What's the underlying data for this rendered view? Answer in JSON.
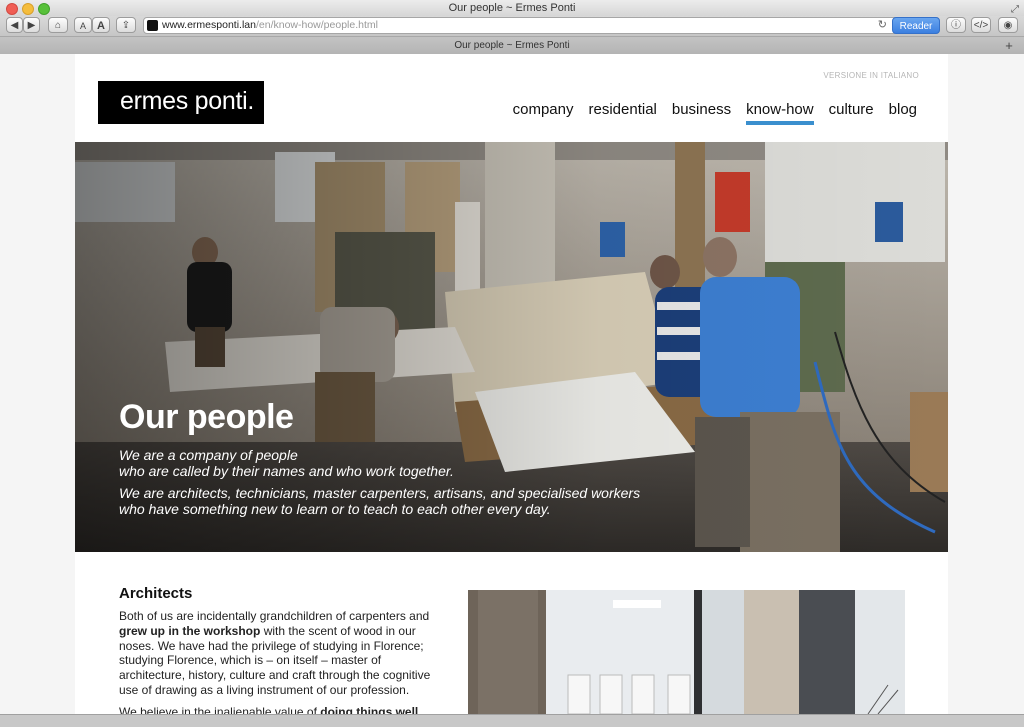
{
  "window": {
    "title": "Our people ~ Ermes Ponti",
    "tab_title": "Our people ~ Ermes Ponti"
  },
  "toolbar": {
    "url_host": "www.ermesponti.lan",
    "url_path": "/en/know-how/people.html",
    "reader_label": "Reader",
    "font_small": "A",
    "font_large": "A"
  },
  "site": {
    "lang_link": "VERSIONE IN ITALIANO",
    "logo_text": "ermes ponti.",
    "nav": [
      {
        "label": "company"
      },
      {
        "label": "residential"
      },
      {
        "label": "business"
      },
      {
        "label": "know-how"
      },
      {
        "label": "culture"
      },
      {
        "label": "blog"
      }
    ],
    "active_nav": "know-how",
    "accent_color": "#3a8fce"
  },
  "hero": {
    "title": "Our people",
    "lines": [
      "We are a company of people",
      "who are called by their names and who work together.",
      "We are architects, technicians, master carpenters, artisans, and specialised workers",
      "who have something new to learn or to teach to each other every day."
    ]
  },
  "section": {
    "title": "Architects",
    "para1_a": "Both of us are incidentally grandchildren of carpenters and",
    "para1_bold": "grew up in the workshop",
    "para1_b": "with the scent of wood in our noses. We have had the privilege of studying in Florence; studying Florence, which is – on itself – master of architecture, history, culture and craft through the cognitive use of drawing as a living instrument of our profession.",
    "para2_a": "We believe in the inalienable value of",
    "para2_bold": "doing things well"
  }
}
